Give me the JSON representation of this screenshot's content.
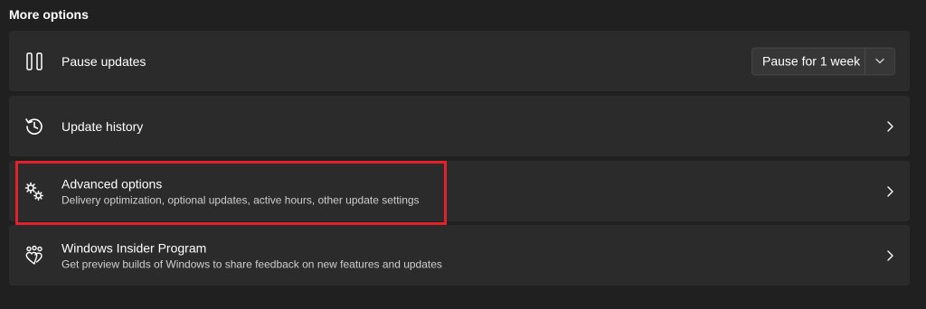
{
  "section": {
    "title": "More options"
  },
  "cards": [
    {
      "title": "Pause updates",
      "icon": "pause-icon",
      "dropdown": {
        "selected": "Pause for 1 week",
        "icon": "chevron-down-icon"
      }
    },
    {
      "title": "Update history",
      "icon": "history-icon",
      "chevron": "chevron-right-icon"
    },
    {
      "title": "Advanced options",
      "subtitle": "Delivery optimization, optional updates, active hours, other update settings",
      "icon": "gears-icon",
      "chevron": "chevron-right-icon"
    },
    {
      "title": "Windows Insider Program",
      "subtitle": "Get preview builds of Windows to share feedback on new features and updates",
      "icon": "insider-hearts-icon",
      "chevron": "chevron-right-icon"
    }
  ],
  "highlight": {
    "color": "#e1212b"
  },
  "colors": {
    "background": "#202020",
    "card": "#2b2b2b",
    "text": "#ffffff",
    "subtext": "#cfcfcf"
  }
}
